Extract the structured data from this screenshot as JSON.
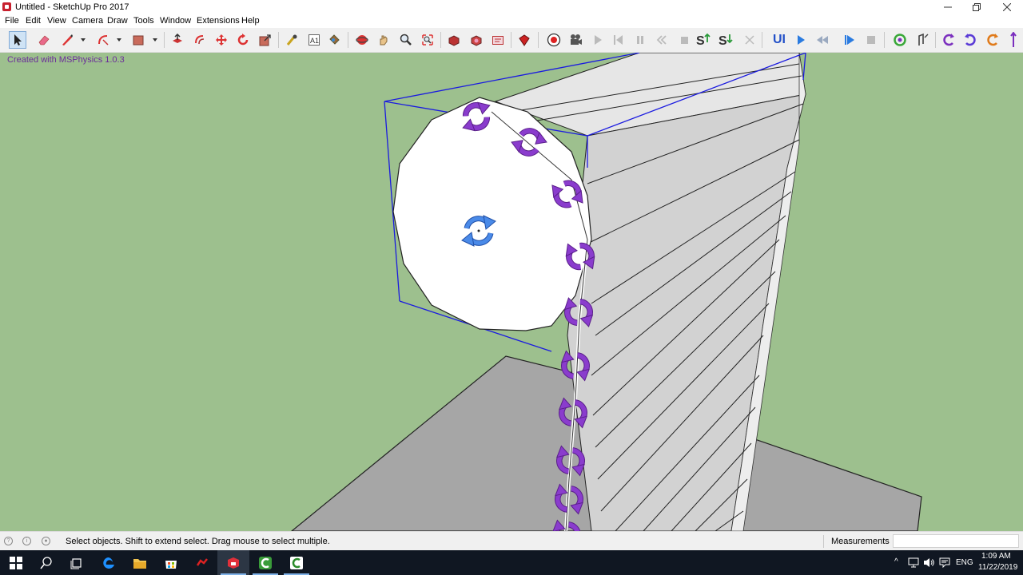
{
  "window": {
    "title": "Untitled - SketchUp Pro 2017",
    "minimize_icon": "minimize-icon",
    "maximize_icon": "restore-icon",
    "close_icon": "close-icon"
  },
  "menu": {
    "items": [
      "File",
      "Edit",
      "View",
      "Camera",
      "Draw",
      "Tools",
      "Window",
      "Extensions",
      "Help"
    ]
  },
  "toolbar": {
    "tools": [
      "select-tool-icon",
      "eraser-tool-icon",
      "line-tool-icon",
      "arc-tool-icon",
      "rectangle-tool-icon",
      "push-pull-tool-icon",
      "offset-tool-icon",
      "move-tool-icon",
      "rotate-tool-icon",
      "scale-tool-icon",
      "tape-measure-tool-icon",
      "text-tool-icon",
      "paint-bucket-tool-icon",
      "orbit-tool-icon",
      "pan-tool-icon",
      "zoom-tool-icon",
      "zoom-extents-tool-icon",
      "warehouse-icon",
      "extension-warehouse-icon",
      "send-to-layout-icon",
      "extension-manager-icon",
      "msphysics-record-icon",
      "msphysics-camera-icon",
      "play-icon",
      "reset-icon",
      "pause-icon",
      "rewind-icon",
      "stop-icon",
      "scene-s-icon",
      "scene-s-down-icon",
      "clear-icon",
      "ui-icon",
      "play-blue-icon",
      "rewind-blue-icon",
      "play-step-icon",
      "stop-grey-icon",
      "refresh-green-icon",
      "joint-tool-icon",
      "rotate-purple-1-icon",
      "rotate-purple-2-icon",
      "rotate-orange-icon"
    ],
    "ui_label": "UI",
    "scene_label": "S"
  },
  "viewport": {
    "credit": "Created with MSPhysics 1.0.3",
    "background_color": "#9dc08e",
    "selection_color": "#1a1ae0",
    "joint_icon_color": "#7b2fbe",
    "center_joint_color": "#3b7fe0"
  },
  "statusbar": {
    "icons": [
      "info-icon",
      "credit-icon",
      "user-icon"
    ],
    "hint": "Select objects. Shift to extend select. Drag mouse to select multiple.",
    "measurements_label": "Measurements",
    "measurements_value": ""
  },
  "taskbar": {
    "apps": [
      "start-icon",
      "search-icon",
      "task-view-icon",
      "edge-icon",
      "explorer-icon",
      "store-icon",
      "app-red-icon",
      "sketchup-icon",
      "camtasia-icon",
      "camtasia-recorder-icon"
    ],
    "tray": {
      "language": "ENG",
      "time": "1:09 AM",
      "date": "11/22/2019"
    }
  }
}
